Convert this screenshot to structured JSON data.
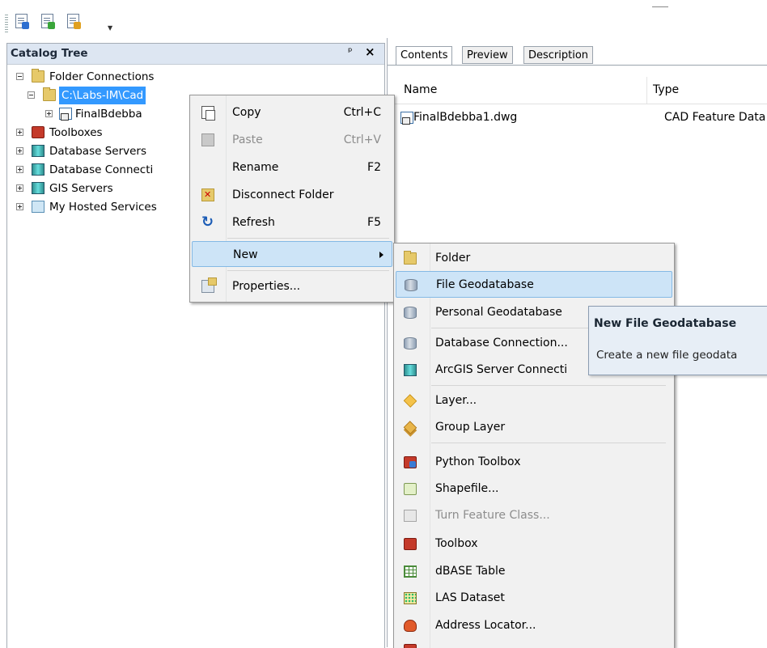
{
  "toolbar": {
    "buttons": [
      "catalog-tree-icon",
      "metadata-icon",
      "search-icon"
    ],
    "overflow_icon": "toolbar-dropdown-icon"
  },
  "catalog_tree": {
    "title": "Catalog Tree",
    "pin_icon": "ꟸ",
    "close_icon": "×",
    "items": [
      {
        "label": "Folder Connections",
        "icon": "folder-connections-icon",
        "expanded": true
      },
      {
        "label": "C:\\Labs-IM\\Cad",
        "icon": "folder-icon",
        "expanded": true,
        "selected": true
      },
      {
        "label": "FinalBdebba",
        "icon": "cad-dataset-icon",
        "expanded": false
      },
      {
        "label": "Toolboxes",
        "icon": "toolboxes-icon",
        "expanded": false
      },
      {
        "label": "Database Servers",
        "icon": "database-servers-icon",
        "expanded": false
      },
      {
        "label": "Database Connecti",
        "icon": "database-connections-icon",
        "expanded": false
      },
      {
        "label": "GIS Servers",
        "icon": "gis-servers-icon",
        "expanded": false
      },
      {
        "label": "My Hosted Services",
        "icon": "hosted-services-icon",
        "expanded": false
      }
    ]
  },
  "contents_panel": {
    "tabs": [
      "Contents",
      "Preview",
      "Description"
    ],
    "active_tab": "Contents",
    "columns": [
      "Name",
      "Type"
    ],
    "rows": [
      {
        "name": "FinalBdebba1.dwg",
        "type": "CAD Feature Data"
      }
    ]
  },
  "context_menu": {
    "items": [
      {
        "label": "Copy",
        "shortcut": "Ctrl+C",
        "icon": "copy-icon",
        "disabled": false
      },
      {
        "label": "Paste",
        "shortcut": "Ctrl+V",
        "icon": "paste-icon",
        "disabled": true
      },
      {
        "label": "Rename",
        "shortcut": "F2",
        "icon": "",
        "disabled": false
      },
      {
        "label": "Disconnect Folder",
        "shortcut": "",
        "icon": "disconnect-folder-icon",
        "disabled": false
      },
      {
        "label": "Refresh",
        "shortcut": "F5",
        "icon": "refresh-icon",
        "disabled": false
      },
      {
        "label": "New",
        "shortcut": "",
        "icon": "",
        "disabled": false,
        "submenu": true,
        "highlighted": true
      },
      {
        "label": "Properties...",
        "shortcut": "",
        "icon": "properties-icon",
        "disabled": false
      }
    ]
  },
  "new_submenu": {
    "items": [
      {
        "label": "Folder",
        "icon": "folder-icon",
        "disabled": false
      },
      {
        "label": "File Geodatabase",
        "icon": "file-geodatabase-icon",
        "disabled": false,
        "highlighted": true
      },
      {
        "label": "Personal Geodatabase",
        "icon": "personal-geodatabase-icon",
        "disabled": false
      },
      {
        "label": "Database Connection...",
        "icon": "database-connection-icon",
        "disabled": false
      },
      {
        "label": "ArcGIS Server Connecti",
        "icon": "arcgis-server-connection-icon",
        "disabled": false
      },
      {
        "label": "Layer...",
        "icon": "layer-icon",
        "disabled": false
      },
      {
        "label": "Group Layer",
        "icon": "group-layer-icon",
        "disabled": false
      },
      {
        "label": "Python Toolbox",
        "icon": "python-toolbox-icon",
        "disabled": false
      },
      {
        "label": "Shapefile...",
        "icon": "shapefile-icon",
        "disabled": false
      },
      {
        "label": "Turn Feature Class...",
        "icon": "turn-feature-class-icon",
        "disabled": true
      },
      {
        "label": "Toolbox",
        "icon": "toolbox-icon",
        "disabled": false
      },
      {
        "label": "dBASE Table",
        "icon": "dbase-table-icon",
        "disabled": false
      },
      {
        "label": "LAS Dataset",
        "icon": "las-dataset-icon",
        "disabled": false
      },
      {
        "label": "Address Locator...",
        "icon": "address-locator-icon",
        "disabled": false
      }
    ]
  },
  "tooltip": {
    "title": "New File Geodatabase",
    "body": "Create a new file geodata"
  }
}
